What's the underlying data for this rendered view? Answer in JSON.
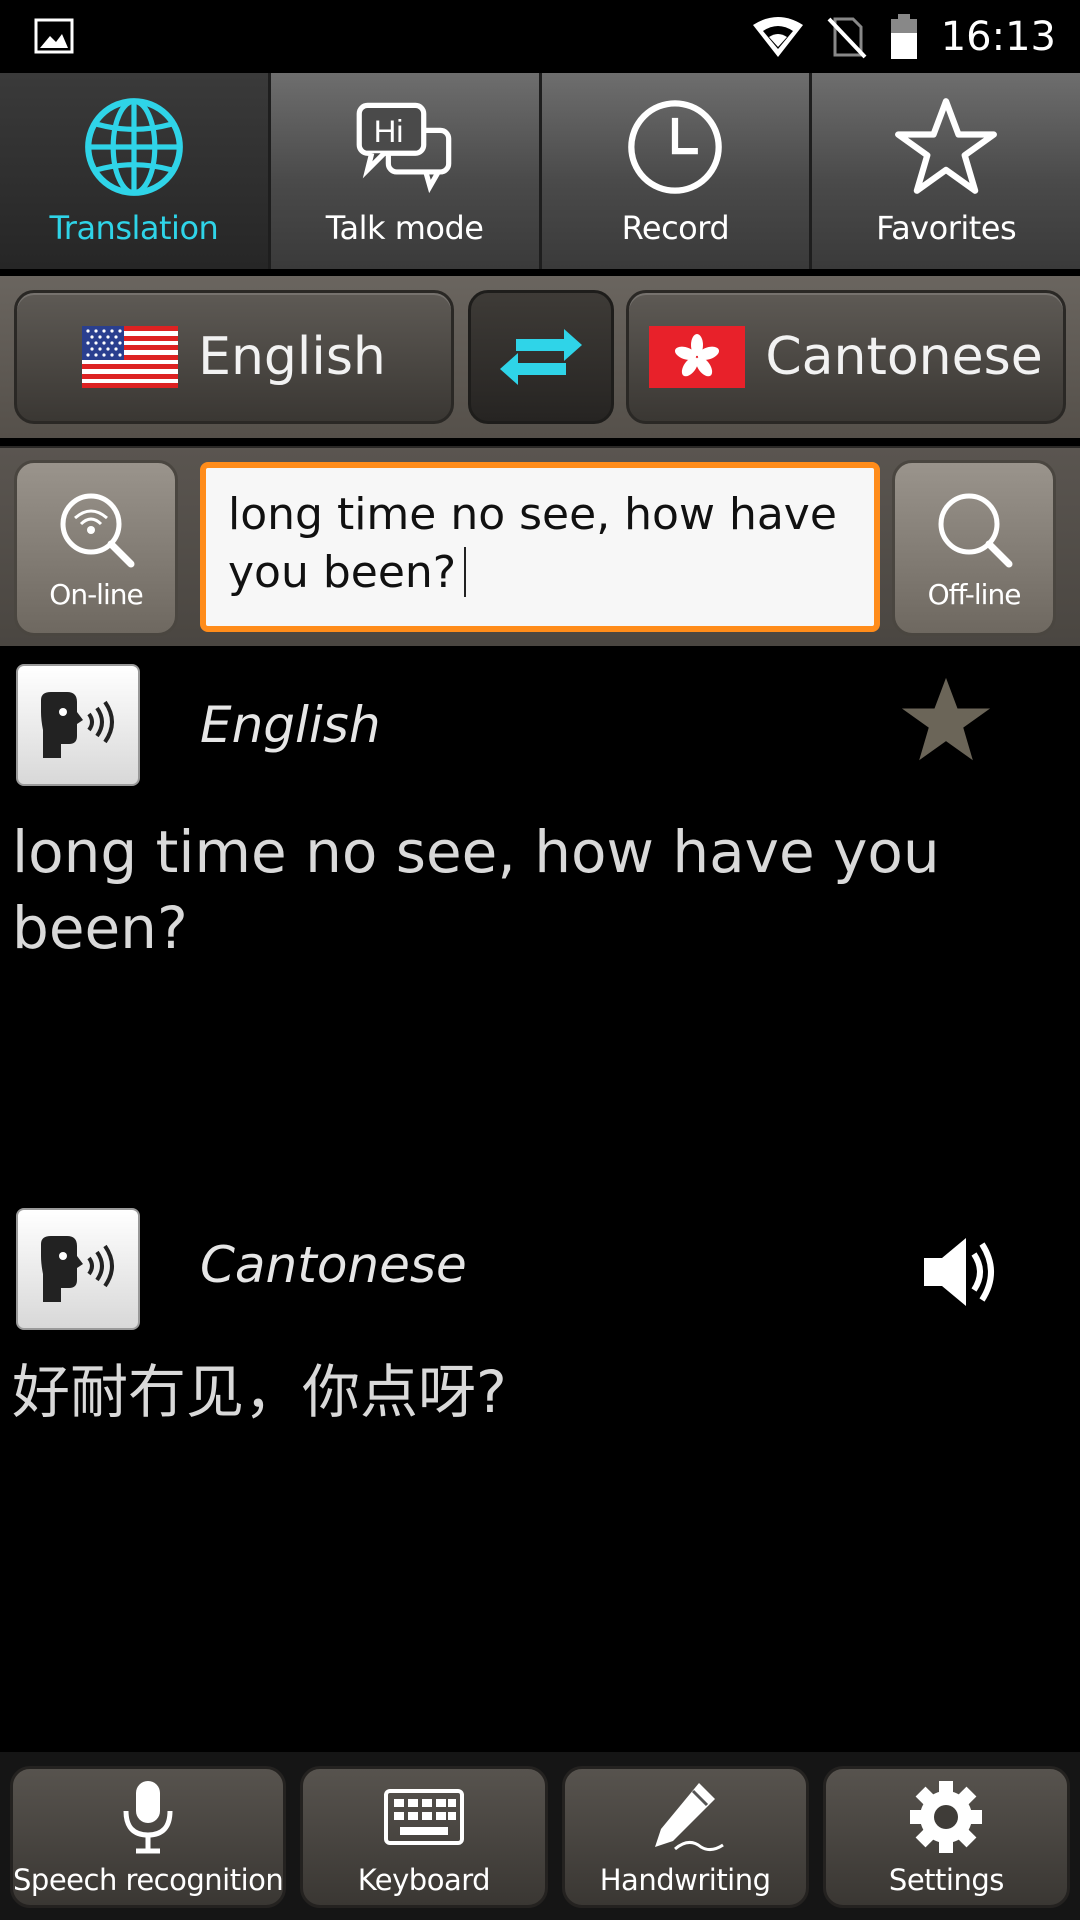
{
  "status_bar": {
    "time": "16:13",
    "icons": [
      "gallery-icon",
      "wifi-icon",
      "no-sim-icon",
      "battery-icon"
    ]
  },
  "top_tabs": [
    {
      "label": "Translation",
      "icon": "globe-icon",
      "active": true
    },
    {
      "label": "Talk mode",
      "icon": "chat-bubbles-icon",
      "active": false
    },
    {
      "label": "Record",
      "icon": "clock-icon",
      "active": false
    },
    {
      "label": "Favorites",
      "icon": "star-outline-icon",
      "active": false
    }
  ],
  "languages": {
    "source": {
      "name": "English",
      "flag": "us-flag-icon"
    },
    "target": {
      "name": "Cantonese",
      "flag": "hk-flag-icon"
    },
    "swap_icon": "swap-arrows-icon"
  },
  "input": {
    "online_label": "On-line",
    "offline_label": "Off-line",
    "value": "long time no see, how have you been?"
  },
  "results": [
    {
      "lang": "English",
      "text": "long time no see, how have you been?",
      "action_icon": "star-filled-icon"
    },
    {
      "lang": "Cantonese",
      "text": "好耐冇见，你点呀?",
      "action_icon": "volume-icon"
    }
  ],
  "bottom_bar": [
    {
      "label": "Speech recognition",
      "icon": "microphone-icon"
    },
    {
      "label": "Keyboard",
      "icon": "keyboard-icon"
    },
    {
      "label": "Handwriting",
      "icon": "pen-icon"
    },
    {
      "label": "Settings",
      "icon": "gear-icon"
    }
  ],
  "colors": {
    "accent_cyan": "#2fd4e8",
    "input_border": "#ff8c1a",
    "background": "#000000"
  }
}
